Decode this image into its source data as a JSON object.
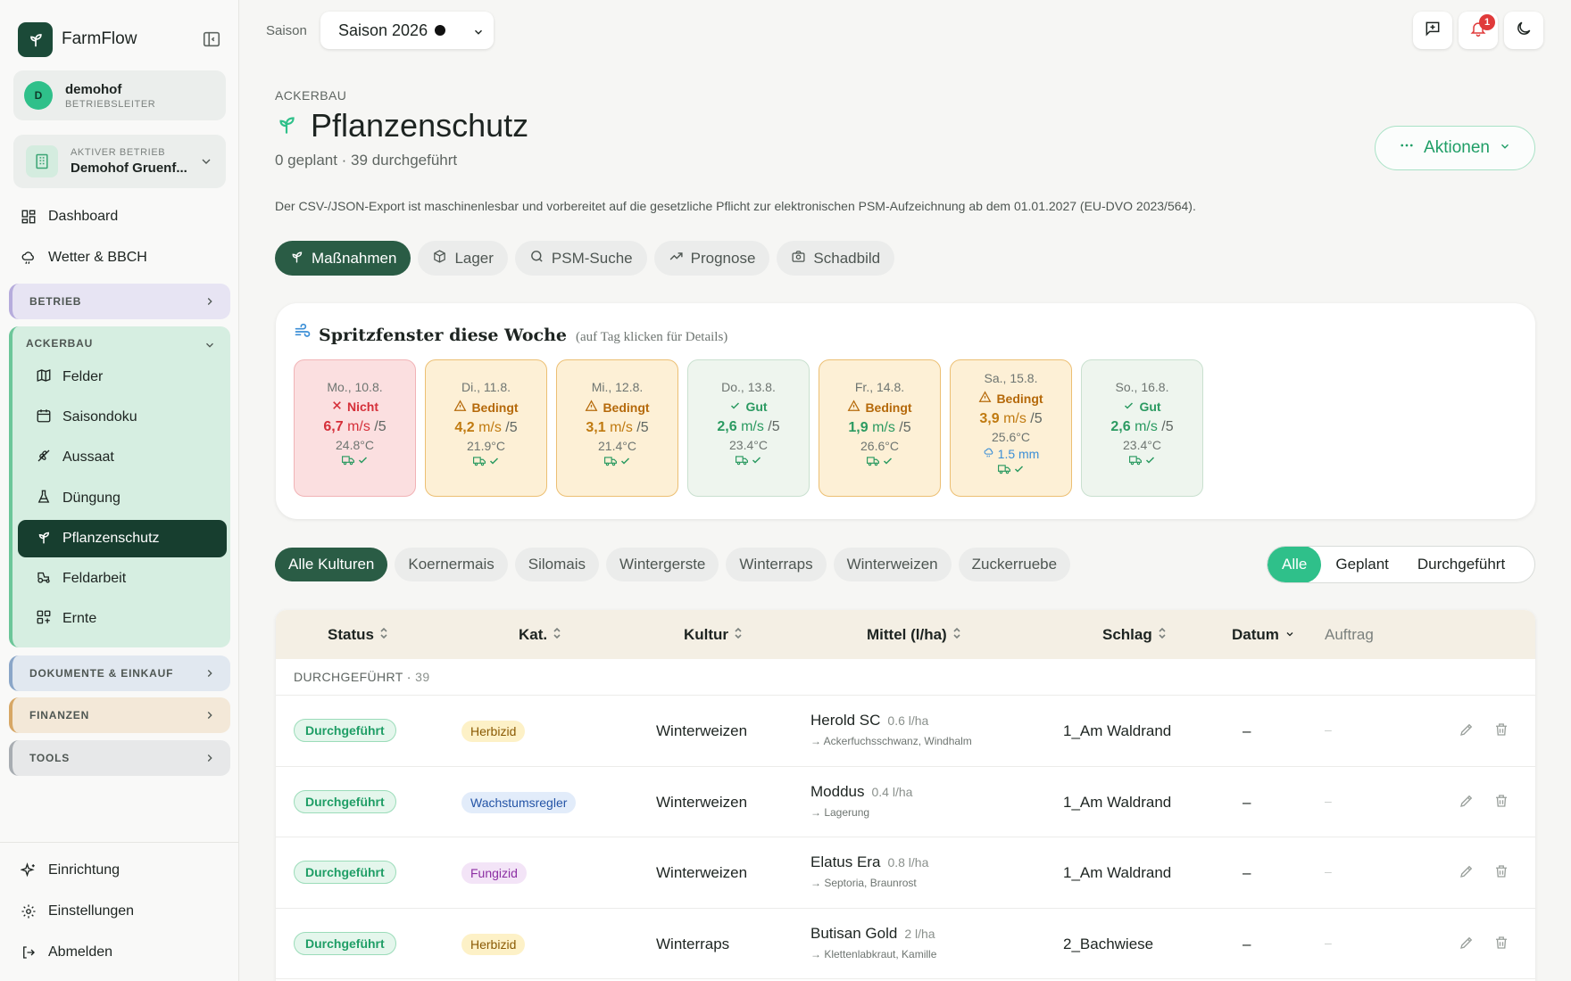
{
  "app": {
    "name": "FarmFlow"
  },
  "user": {
    "initial": "D",
    "name": "demohof",
    "role": "BETRIEBSLEITER"
  },
  "farm": {
    "label": "AKTIVER BETRIEB",
    "name": "Demohof Gruenf..."
  },
  "nav": {
    "dashboard": "Dashboard",
    "wetter": "Wetter & BBCH",
    "betrieb": "BETRIEB",
    "ackerbau": "ACKERBAU",
    "ackerbau_items": [
      "Felder",
      "Saisondoku",
      "Aussaat",
      "Düngung",
      "Pflanzenschutz",
      "Feldarbeit",
      "Ernte"
    ],
    "dokumente": "DOKUMENTE & EINKAUF",
    "finanzen": "FINANZEN",
    "tools": "TOOLS",
    "einrichtung": "Einrichtung",
    "einstellungen": "Einstellungen",
    "abmelden": "Abmelden"
  },
  "topbar": {
    "season_label": "Saison",
    "season_value": "Saison 2026",
    "notification_count": "1"
  },
  "header": {
    "eyebrow": "ACKERBAU",
    "title": "Pflanzenschutz",
    "subtitle": "0 geplant · 39 durchgeführt",
    "actions_label": "Aktionen",
    "note": "Der CSV-/JSON-Export ist maschinenlesbar und vorbereitet auf die gesetzliche Pflicht zur elektronischen PSM-Aufzeichnung ab dem 01.01.2027 (EU-DVO 2023/564)."
  },
  "tabs": [
    "Maßnahmen",
    "Lager",
    "PSM-Suche",
    "Prognose",
    "Schadbild"
  ],
  "spray": {
    "title": "Spritzfenster diese Woche",
    "hint": "(auf Tag klicken für Details)",
    "days": [
      {
        "date": "Mo., 10.8.",
        "status": "Nicht",
        "wind": "6,7",
        "unit": "m/s",
        "scale": "/5",
        "temp": "24.8°C",
        "rain": ""
      },
      {
        "date": "Di., 11.8.",
        "status": "Bedingt",
        "wind": "4,2",
        "unit": "m/s",
        "scale": "/5",
        "temp": "21.9°C",
        "rain": ""
      },
      {
        "date": "Mi., 12.8.",
        "status": "Bedingt",
        "wind": "3,1",
        "unit": "m/s",
        "scale": "/5",
        "temp": "21.4°C",
        "rain": ""
      },
      {
        "date": "Do., 13.8.",
        "status": "Gut",
        "wind": "2,6",
        "unit": "m/s",
        "scale": "/5",
        "temp": "23.4°C",
        "rain": ""
      },
      {
        "date": "Fr., 14.8.",
        "status": "Bedingt",
        "wind": "1,9",
        "unit": "m/s",
        "scale": "/5",
        "temp": "26.6°C",
        "rain": ""
      },
      {
        "date": "Sa., 15.8.",
        "status": "Bedingt",
        "wind": "3,9",
        "unit": "m/s",
        "scale": "/5",
        "temp": "25.6°C",
        "rain": "1.5 mm"
      },
      {
        "date": "So., 16.8.",
        "status": "Gut",
        "wind": "2,6",
        "unit": "m/s",
        "scale": "/5",
        "temp": "23.4°C",
        "rain": ""
      }
    ]
  },
  "filters": {
    "cultures": [
      "Alle Kulturen",
      "Koernermais",
      "Silomais",
      "Wintergerste",
      "Winterraps",
      "Winterweizen",
      "Zuckerruebe"
    ],
    "status": [
      "Alle",
      "Geplant",
      "Durchgeführt"
    ]
  },
  "table": {
    "columns": [
      "Status",
      "Kat.",
      "Kultur",
      "Mittel (l/ha)",
      "Schlag",
      "Datum",
      "Auftrag"
    ],
    "group": {
      "label": "DURCHGEFÜHRT",
      "count": "39"
    },
    "rows": [
      {
        "status": "Durchgeführt",
        "category": "Herbizid",
        "kultur": "Winterweizen",
        "mittel": "Herold SC",
        "dose": "0.6 l/ha",
        "target": "→ Ackerfuchsschwanz, Windhalm",
        "schlag": "1_Am Waldrand",
        "datum": "–",
        "auftrag": "–"
      },
      {
        "status": "Durchgeführt",
        "category": "Wachstumsregler",
        "kultur": "Winterweizen",
        "mittel": "Moddus",
        "dose": "0.4 l/ha",
        "target": "→ Lagerung",
        "schlag": "1_Am Waldrand",
        "datum": "–",
        "auftrag": "–"
      },
      {
        "status": "Durchgeführt",
        "category": "Fungizid",
        "kultur": "Winterweizen",
        "mittel": "Elatus Era",
        "dose": "0.8 l/ha",
        "target": "→ Septoria, Braunrost",
        "schlag": "1_Am Waldrand",
        "datum": "–",
        "auftrag": "–"
      },
      {
        "status": "Durchgeführt",
        "category": "Herbizid",
        "kultur": "Winterraps",
        "mittel": "Butisan Gold",
        "dose": "2 l/ha",
        "target": "→ Klettenlabkraut, Kamille",
        "schlag": "2_Bachwiese",
        "datum": "–",
        "auftrag": "–"
      }
    ]
  },
  "colors": {
    "brand": "#1b4a38",
    "accent": "#2fc08a",
    "bad": "#d52f39",
    "warn": "#b5690a",
    "good": "#2b9a61"
  }
}
